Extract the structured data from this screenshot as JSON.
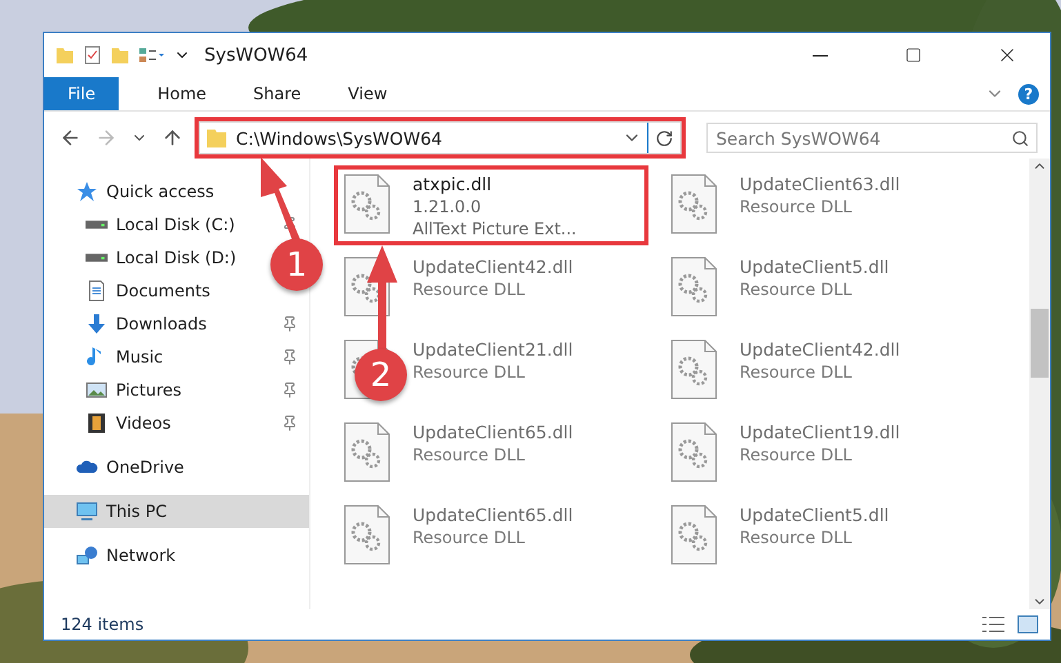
{
  "window": {
    "title": "SysWOW64"
  },
  "ribbon": {
    "tabs": [
      {
        "label": "File",
        "kind": "file"
      },
      {
        "label": "Home",
        "kind": "plain"
      },
      {
        "label": "Share",
        "kind": "plain"
      },
      {
        "label": "View",
        "kind": "plain"
      }
    ]
  },
  "address": {
    "path": "C:\\Windows\\SysWOW64",
    "highlighted": true
  },
  "search": {
    "placeholder": "Search SysWOW64"
  },
  "nav": [
    {
      "label": "Quick access",
      "kind": "star",
      "selected": false,
      "children": [
        {
          "label": "Local Disk (C:)",
          "kind": "disk",
          "pinned": true,
          "selected": false
        },
        {
          "label": "Local Disk (D:)",
          "kind": "disk",
          "pinned": false,
          "selected": false
        },
        {
          "label": "Documents",
          "kind": "doc",
          "pinned": false,
          "selected": false
        },
        {
          "label": "Downloads",
          "kind": "download",
          "pinned": true,
          "selected": false
        },
        {
          "label": "Music",
          "kind": "music",
          "pinned": true,
          "selected": false
        },
        {
          "label": "Pictures",
          "kind": "pictures",
          "pinned": true,
          "selected": false
        },
        {
          "label": "Videos",
          "kind": "video",
          "pinned": true,
          "selected": false
        }
      ]
    },
    {
      "label": "OneDrive",
      "kind": "cloud",
      "selected": false
    },
    {
      "label": "This PC",
      "kind": "pc",
      "selected": true
    },
    {
      "label": "Network",
      "kind": "network",
      "selected": false
    }
  ],
  "files": [
    {
      "name": "atxpic.dll",
      "lines": [
        "1.21.0.0",
        "AllText Picture Ext..."
      ],
      "highlighted": true,
      "blurred": false
    },
    {
      "name": "UpdateClient63.dll",
      "lines": [
        "Resource DLL"
      ],
      "highlighted": false,
      "blurred": true
    },
    {
      "name": "UpdateClient42.dll",
      "lines": [
        "Resource DLL"
      ],
      "highlighted": false,
      "blurred": true
    },
    {
      "name": "UpdateClient5.dll",
      "lines": [
        "Resource DLL"
      ],
      "highlighted": false,
      "blurred": true
    },
    {
      "name": "UpdateClient21.dll",
      "lines": [
        "Resource DLL"
      ],
      "highlighted": false,
      "blurred": true
    },
    {
      "name": "UpdateClient42.dll",
      "lines": [
        "Resource DLL"
      ],
      "highlighted": false,
      "blurred": true
    },
    {
      "name": "UpdateClient65.dll",
      "lines": [
        "Resource DLL"
      ],
      "highlighted": false,
      "blurred": true
    },
    {
      "name": "UpdateClient19.dll",
      "lines": [
        "Resource DLL"
      ],
      "highlighted": false,
      "blurred": true
    },
    {
      "name": "UpdateClient65.dll",
      "lines": [
        "Resource DLL"
      ],
      "highlighted": false,
      "blurred": true
    },
    {
      "name": "UpdateClient5.dll",
      "lines": [
        "Resource DLL"
      ],
      "highlighted": false,
      "blurred": true
    }
  ],
  "help": {
    "label": "?"
  },
  "status_bar": {
    "count": "124 items"
  },
  "callouts": [
    {
      "number": "1"
    },
    {
      "number": "2"
    }
  ]
}
